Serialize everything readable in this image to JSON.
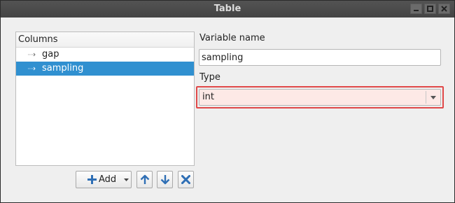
{
  "window": {
    "title": "Table",
    "controls": [
      "minimize-icon",
      "maximize-icon",
      "close-icon"
    ]
  },
  "columns": {
    "header": "Columns",
    "items": [
      {
        "label": "gap",
        "selected": false,
        "icon": "variable-icon"
      },
      {
        "label": "sampling",
        "selected": true,
        "icon": "variable-icon"
      }
    ]
  },
  "toolbar": {
    "add_label": "Add",
    "add_icon": "plus-icon",
    "up_icon": "arrow-up-icon",
    "down_icon": "arrow-down-icon",
    "delete_icon": "x-icon"
  },
  "form": {
    "variable_name_label": "Variable name",
    "variable_name_value": "sampling",
    "type_label": "Type",
    "type_value": "int"
  },
  "colors": {
    "selection": "#3090d0",
    "accent_blue": "#2f6fb5",
    "error_outline": "#e04848",
    "error_fill": "#fde9e6"
  }
}
